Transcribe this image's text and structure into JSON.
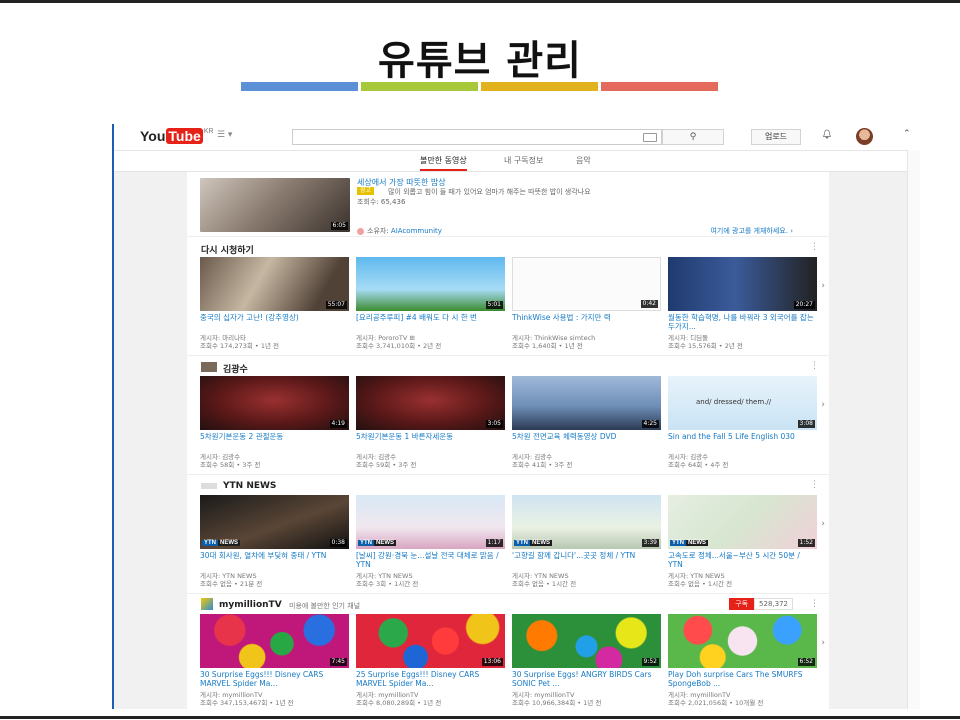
{
  "slide": {
    "title": "유튜브 관리",
    "bar_colors": [
      "#5b8fd6",
      "#a6c83a",
      "#e2b21e",
      "#e46a5e"
    ]
  },
  "youtube": {
    "logo_you": "You",
    "logo_tube": "Tube",
    "logo_region": "KR",
    "guide_icon": "☰ ▾",
    "search_placeholder": "",
    "search_icon": "⚲",
    "upload_label": "업로드",
    "bell_icon": "🔔",
    "scroll_cap": "⌃",
    "tabs": [
      {
        "label": "볼만한 동영상",
        "active": true
      },
      {
        "label": "내 구독정보",
        "active": false
      },
      {
        "label": "음악",
        "active": false
      }
    ],
    "ad": {
      "duration": "6:05",
      "title": "세상에서 가장 따뜻한 밥상",
      "badge": "광고",
      "description": "많이 외롭고 힘이 들 때가 있어요 엄마가 해주는 따뜻한 밥이 생각나요",
      "views": "조회수: 65,436",
      "owner_prefix": "소유자:",
      "owner": "AIAcommunity",
      "why": "여기에 광고를 게재하세요. ›"
    },
    "sections": [
      {
        "title": "다시 시청하기",
        "videos": [
          {
            "title": "중국의 십자가 고난! (강추영상)",
            "channel": "게시자: 마리나타",
            "meta": "조회수 174,273회 • 1년 전",
            "duration": "55:07"
          },
          {
            "title": "[요리공주루피] #4 배워도 다 시 한 번",
            "channel": "게시자: PororoTV ⊞",
            "meta": "조회수 3,741,010회 • 2년 전",
            "duration": "5:01"
          },
          {
            "title": "ThinkWise 사용법 : 가지만 력",
            "channel": "게시자: ThinkWise simtech",
            "meta": "조회수 1,640회 • 1년 전",
            "duration": "0:42"
          },
          {
            "title": "월동한 학습혁명, 나를 바꿔라 3 외국어를 잡는 두가지...",
            "channel": "게시자: 디딤돌",
            "meta": "조회수 15,576회 • 2년 전",
            "duration": "20:27"
          }
        ]
      },
      {
        "title": "김광수",
        "videos": [
          {
            "title": "5차원기본운동 2 관절운동",
            "channel": "게시자: 김광수",
            "meta": "조회수 58회 • 3주 전",
            "duration": "4:19"
          },
          {
            "title": "5차원기본운동 1 바른자세운동",
            "channel": "게시자: 김광수",
            "meta": "조회수 59회 • 3주 전",
            "duration": "3:05"
          },
          {
            "title": "5차원 전면교육 체력동영상 DVD",
            "channel": "게시자: 김광수",
            "meta": "조회수 41회 • 3주 전",
            "duration": "4:25"
          },
          {
            "title": "Sin and the Fall 5 Life English 030",
            "channel": "게시자: 김광수",
            "meta": "조회수 64회 • 4주 전",
            "duration": "3:08",
            "thumb_text": "and/ dressed/ them.//"
          }
        ]
      },
      {
        "title": "YTN NEWS",
        "videos": [
          {
            "title": "30대 회사원, 열차에 부딪혀 중태 / YTN",
            "channel": "게시자: YTN NEWS",
            "meta": "조회수 없음 • 21분 전",
            "duration": "0:38"
          },
          {
            "title": "[날씨] 강원·경북 눈...설날 전국 대체로 맑음 / YTN",
            "channel": "게시자: YTN NEWS",
            "meta": "조회수 3회 • 1시간 전",
            "duration": "1:17"
          },
          {
            "title": "'고향길 함께 갑니다'...곳곳 정체 / YTN",
            "channel": "게시자: YTN NEWS",
            "meta": "조회수 없음 • 1시간 전",
            "duration": "3:39"
          },
          {
            "title": "고속도로 정체...서울~부산 5 시간 50분 / YTN",
            "channel": "게시자: YTN NEWS",
            "meta": "조회수 없음 • 1시간 전",
            "duration": "1:52"
          }
        ],
        "thumb_logo_a": "YTN",
        "thumb_logo_b": "NEWS"
      },
      {
        "title": "mymillionTV",
        "subtitle": "미용에 볼만한 인기 채널",
        "subscribe": "구독",
        "subscribers": "528,372",
        "videos": [
          {
            "title": "30 Surprise Eggs!!! Disney CARS MARVEL Spider Ma...",
            "channel": "게시자: mymillionTV",
            "meta": "조회수 347,153,467회 • 1년 전",
            "duration": "7:45"
          },
          {
            "title": "25 Surprise Eggs!!! Disney CARS MARVEL Spider Ma...",
            "channel": "게시자: mymillionTV",
            "meta": "조회수 8,080,289회 • 1년 전",
            "duration": "13:06"
          },
          {
            "title": "30 Surprise Eggs! ANGRY BIRDS Cars SONIC Pet ...",
            "channel": "게시자: mymillionTV",
            "meta": "조회수 10,966,384회 • 1년 전",
            "duration": "9:52"
          },
          {
            "title": "Play Doh surprise Cars The SMURFS SpongeBob ...",
            "channel": "게시자: mymillionTV",
            "meta": "조회수 2,021,056회 • 10개월 전",
            "duration": "6:52"
          }
        ]
      }
    ],
    "next_arrow": "›",
    "more_icon": "⋮"
  }
}
